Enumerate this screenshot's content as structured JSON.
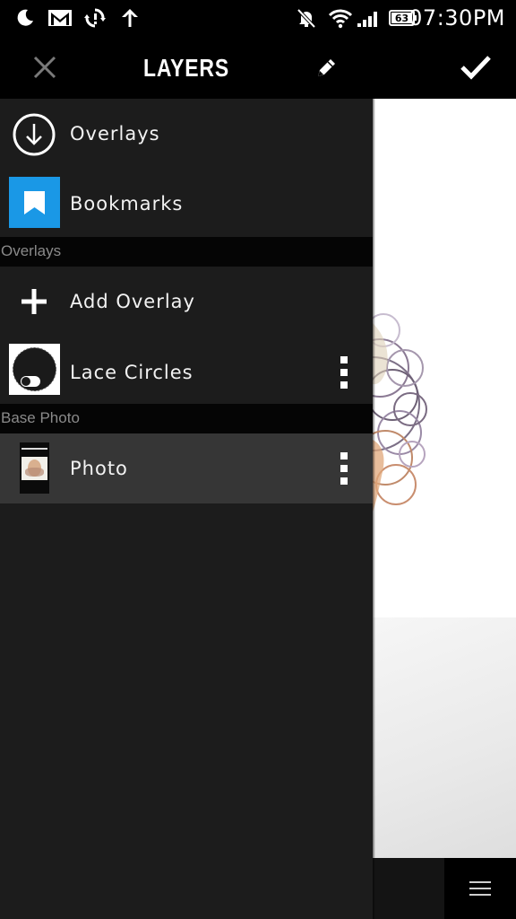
{
  "status_bar": {
    "time": "07:30PM",
    "battery": "63",
    "icons": [
      "moon-icon",
      "gmail-icon",
      "sync-icon",
      "upload-arrow-icon",
      "muted-bell-icon",
      "wifi-icon",
      "signal-icon",
      "battery-icon"
    ]
  },
  "header": {
    "title": "LAYERS",
    "close_icon": "close-icon",
    "edit_icon": "pencil-icon",
    "confirm_icon": "checkmark-icon"
  },
  "menu": {
    "overlays_label": "Overlays",
    "bookmarks_label": "Bookmarks"
  },
  "sections": {
    "overlays": "Overlays",
    "base_photo": "Base Photo"
  },
  "overlay_items": {
    "add_label": "Add Overlay",
    "lace_label": "Lace Circles"
  },
  "base_items": {
    "photo_label": "Photo"
  },
  "colors": {
    "accent": "#1a98e6",
    "drawer_bg": "#1c1c1c",
    "selected_row": "#363636",
    "section_bg": "#050505"
  }
}
